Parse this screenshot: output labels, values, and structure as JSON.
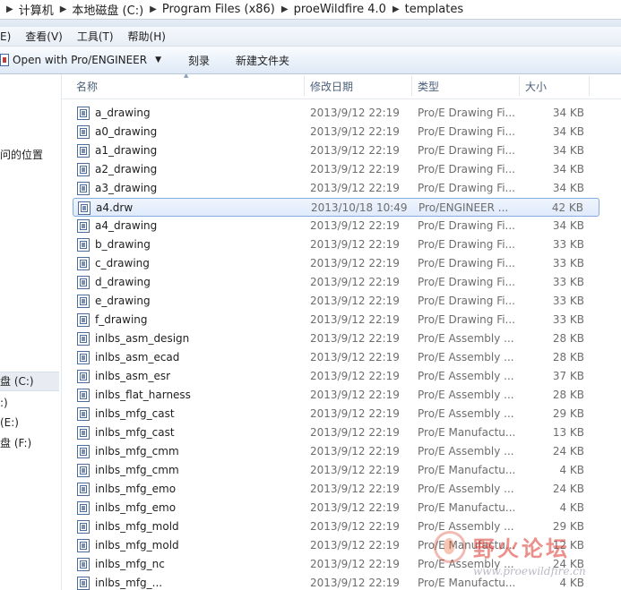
{
  "address_bar": {
    "crumbs": [
      "计算机",
      "本地磁盘 (C:)",
      "Program Files (x86)",
      "proeWildfire 4.0",
      "templates"
    ]
  },
  "menu": {
    "items": [
      "E)",
      "查看(V)",
      "工具(T)",
      "帮助(H)"
    ]
  },
  "toolbar": {
    "open_with_label": "Open with Pro/ENGINEER",
    "burn_label": "刻录",
    "new_folder_label": "新建文件夹"
  },
  "nav": {
    "recent_places": "问的位置",
    "drive_c": "盘 (C:)",
    "drive_d": ":)",
    "drive_e": "(E:)",
    "drive_f": "盘 (F:)"
  },
  "columns": {
    "name": "名称",
    "date": "修改日期",
    "type": "类型",
    "size": "大小"
  },
  "files": [
    {
      "name": "a_drawing",
      "date": "2013/9/12 22:19",
      "type": "Pro/E Drawing Fi...",
      "size": "34 KB"
    },
    {
      "name": "a0_drawing",
      "date": "2013/9/12 22:19",
      "type": "Pro/E Drawing Fi...",
      "size": "34 KB"
    },
    {
      "name": "a1_drawing",
      "date": "2013/9/12 22:19",
      "type": "Pro/E Drawing Fi...",
      "size": "34 KB"
    },
    {
      "name": "a2_drawing",
      "date": "2013/9/12 22:19",
      "type": "Pro/E Drawing Fi...",
      "size": "34 KB"
    },
    {
      "name": "a3_drawing",
      "date": "2013/9/12 22:19",
      "type": "Pro/E Drawing Fi...",
      "size": "34 KB"
    },
    {
      "name": "a4.drw",
      "date": "2013/10/18 10:49",
      "type": "Pro/ENGINEER ...",
      "size": "42 KB",
      "selected": true
    },
    {
      "name": "a4_drawing",
      "date": "2013/9/12 22:19",
      "type": "Pro/E Drawing Fi...",
      "size": "34 KB"
    },
    {
      "name": "b_drawing",
      "date": "2013/9/12 22:19",
      "type": "Pro/E Drawing Fi...",
      "size": "33 KB"
    },
    {
      "name": "c_drawing",
      "date": "2013/9/12 22:19",
      "type": "Pro/E Drawing Fi...",
      "size": "33 KB"
    },
    {
      "name": "d_drawing",
      "date": "2013/9/12 22:19",
      "type": "Pro/E Drawing Fi...",
      "size": "33 KB"
    },
    {
      "name": "e_drawing",
      "date": "2013/9/12 22:19",
      "type": "Pro/E Drawing Fi...",
      "size": "33 KB"
    },
    {
      "name": "f_drawing",
      "date": "2013/9/12 22:19",
      "type": "Pro/E Drawing Fi...",
      "size": "33 KB"
    },
    {
      "name": "inlbs_asm_design",
      "date": "2013/9/12 22:19",
      "type": "Pro/E Assembly ...",
      "size": "28 KB"
    },
    {
      "name": "inlbs_asm_ecad",
      "date": "2013/9/12 22:19",
      "type": "Pro/E Assembly ...",
      "size": "28 KB"
    },
    {
      "name": "inlbs_asm_esr",
      "date": "2013/9/12 22:19",
      "type": "Pro/E Assembly ...",
      "size": "37 KB"
    },
    {
      "name": "inlbs_flat_harness",
      "date": "2013/9/12 22:19",
      "type": "Pro/E Assembly ...",
      "size": "28 KB"
    },
    {
      "name": "inlbs_mfg_cast",
      "date": "2013/9/12 22:19",
      "type": "Pro/E Assembly ...",
      "size": "29 KB"
    },
    {
      "name": "inlbs_mfg_cast",
      "date": "2013/9/12 22:19",
      "type": "Pro/E Manufactu...",
      "size": "13 KB"
    },
    {
      "name": "inlbs_mfg_cmm",
      "date": "2013/9/12 22:19",
      "type": "Pro/E Assembly ...",
      "size": "24 KB"
    },
    {
      "name": "inlbs_mfg_cmm",
      "date": "2013/9/12 22:19",
      "type": "Pro/E Manufactu...",
      "size": "4 KB"
    },
    {
      "name": "inlbs_mfg_emo",
      "date": "2013/9/12 22:19",
      "type": "Pro/E Assembly ...",
      "size": "24 KB"
    },
    {
      "name": "inlbs_mfg_emo",
      "date": "2013/9/12 22:19",
      "type": "Pro/E Manufactu...",
      "size": "4 KB"
    },
    {
      "name": "inlbs_mfg_mold",
      "date": "2013/9/12 22:19",
      "type": "Pro/E Assembly ...",
      "size": "29 KB"
    },
    {
      "name": "inlbs_mfg_mold",
      "date": "2013/9/12 22:19",
      "type": "Pro/E Manufactu...",
      "size": "12 KB"
    },
    {
      "name": "inlbs_mfg_nc",
      "date": "2013/9/12 22:19",
      "type": "Pro/E Assembly ...",
      "size": "24 KB"
    },
    {
      "name": "inlbs_mfg_...",
      "date": "2013/9/12 22:19",
      "type": "Pro/E Manufactu...",
      "size": "4 KB"
    }
  ],
  "watermark": {
    "text": "野火论坛",
    "url": "www.proewildfire.cn"
  }
}
